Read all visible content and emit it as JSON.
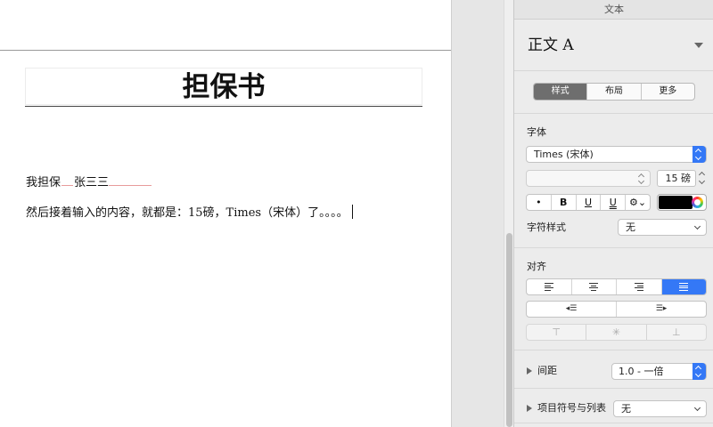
{
  "document": {
    "title": "担保书",
    "line1": {
      "prefix": "我担保",
      "name": "张三三"
    },
    "line2": "然后接着输入的内容，就都是：15磅，Times（宋体）了。。。。"
  },
  "inspector": {
    "header": "文本",
    "paragraph_style": "正文 A",
    "tabs": [
      {
        "label": "样式",
        "active": true
      },
      {
        "label": "布局",
        "active": false
      },
      {
        "label": "更多",
        "active": false
      }
    ],
    "font": {
      "section_label": "字体",
      "family": "Times (宋体)",
      "typeface": "",
      "size": "15 磅",
      "buttons": [
        "•",
        "B",
        "U",
        "U",
        "⚙︎⌄"
      ],
      "text_color": "#000000"
    },
    "char_style": {
      "label": "字符样式",
      "value": "无"
    },
    "alignment": {
      "section_label": "对齐",
      "options": [
        "align-left",
        "align-center",
        "align-right",
        "justify"
      ],
      "selected": "justify",
      "indent": [
        "decrease-indent",
        "increase-indent"
      ],
      "vertical": [
        "top",
        "middle",
        "bottom"
      ]
    },
    "spacing": {
      "label": "间距",
      "value": "1.0 - 一倍"
    },
    "bullets": {
      "label": "项目符号与列表",
      "value": "无"
    }
  }
}
